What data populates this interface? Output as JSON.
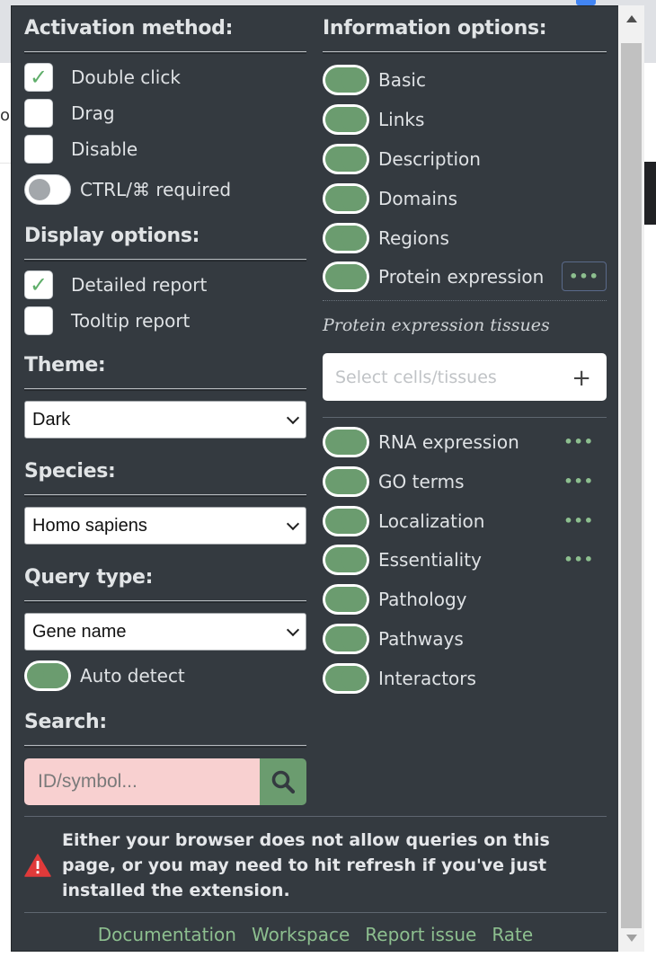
{
  "background": {
    "partial_letter": "or"
  },
  "activation": {
    "heading": "Activation method:",
    "options": [
      {
        "label": "Double click",
        "checked": true
      },
      {
        "label": "Drag",
        "checked": false
      },
      {
        "label": "Disable",
        "checked": false
      }
    ],
    "ctrl_toggle": {
      "label": "CTRL/⌘ required",
      "on": false
    }
  },
  "display": {
    "heading": "Display options:",
    "options": [
      {
        "label": "Detailed report",
        "checked": true
      },
      {
        "label": "Tooltip report",
        "checked": false
      }
    ]
  },
  "theme": {
    "heading": "Theme:",
    "value": "Dark"
  },
  "species": {
    "heading": "Species:",
    "value": "Homo sapiens"
  },
  "query": {
    "heading": "Query type:",
    "value": "Gene name",
    "auto_detect": {
      "label": "Auto detect",
      "on": true
    }
  },
  "search": {
    "heading": "Search:",
    "placeholder": "ID/symbol..."
  },
  "information": {
    "heading": "Information options:",
    "items_top": [
      {
        "label": "Basic",
        "on": true
      },
      {
        "label": "Links",
        "on": true
      },
      {
        "label": "Description",
        "on": true
      },
      {
        "label": "Domains",
        "on": true
      },
      {
        "label": "Regions",
        "on": true
      },
      {
        "label": "Protein expression",
        "on": true,
        "more": "•••"
      }
    ],
    "tissues": {
      "title": "Protein expression tissues",
      "placeholder": "Select cells/tissues",
      "add_symbol": "+"
    },
    "items_bottom": [
      {
        "label": "RNA expression",
        "on": true,
        "more": "•••"
      },
      {
        "label": "GO terms",
        "on": true,
        "more": "•••"
      },
      {
        "label": "Localization",
        "on": true,
        "more": "•••"
      },
      {
        "label": "Essentiality",
        "on": true,
        "more": "•••"
      },
      {
        "label": "Pathology",
        "on": true
      },
      {
        "label": "Pathways",
        "on": true
      },
      {
        "label": "Interactors",
        "on": true
      }
    ]
  },
  "warning": {
    "icon": "warning-triangle-icon",
    "text": "Either your browser does not allow queries on this page, or you may need to hit refresh if you've just installed the extension."
  },
  "footer": {
    "links": [
      "Documentation",
      "Workspace",
      "Report issue",
      "Rate"
    ]
  },
  "colors": {
    "panel": "#343a40",
    "accent": "#6b9c6f",
    "link": "#8dbf8f",
    "warning": "#e03a3a",
    "search_bg": "#f8d0d0"
  }
}
